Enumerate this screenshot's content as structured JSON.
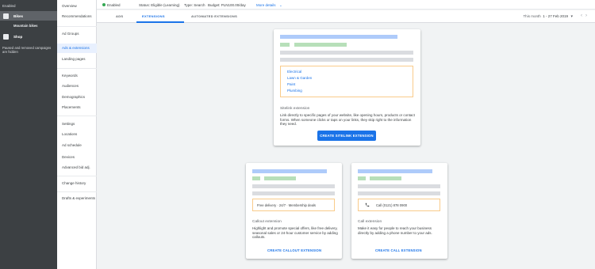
{
  "dark_nav": {
    "enabled_label": "Enabled",
    "campaigns": [
      {
        "label": "Bikes"
      },
      {
        "label": "Shop"
      }
    ],
    "adgroup_label": "Mountain bikes",
    "hidden_note": "Paused and removed campaigns are hidden"
  },
  "sub_nav": {
    "items": [
      "Overview",
      "Recommendations",
      "Ad Groups",
      "Ads & extensions",
      "Landing pages",
      "Keywords",
      "Audiences",
      "Demographics",
      "Placements",
      "Settings",
      "Locations",
      "Ad schedule",
      "Devices",
      "Advanced bid adj.",
      "Change history",
      "Drafts & experiments"
    ],
    "active_index": 3
  },
  "status_bar": {
    "status": "Enabled",
    "campaign_status": "Status: Eligible (Learning)",
    "type": "Type: Search",
    "budget": "Budget: PLN100.00/day",
    "more": "More details"
  },
  "tabs": {
    "items": [
      "ADS",
      "EXTENSIONS",
      "AUTOMATED EXTENSIONS"
    ],
    "active_index": 1,
    "date_prefix": "This month",
    "date_range": "1 - 27 Feb 2019"
  },
  "sitelink_card": {
    "links": [
      "Electrical",
      "Lawn & Garden",
      "Paint",
      "Plumbing"
    ],
    "title": "Sitelink extension",
    "description": "Link directly to specific pages of your website, like opening hours, products or contact forms. When someone clicks or taps on your links, they skip right to the information they need.",
    "button": "CREATE SITELINK EXTENSION"
  },
  "callout_card": {
    "snippet": "Free delivery · 24/7 · Membership deals",
    "title": "Callout extension",
    "description": "Highlight and promote special offers, like free delivery, seasonal sales or 24-hour customer service by adding callouts.",
    "button": "CREATE CALLOUT EXTENSION"
  },
  "call_card": {
    "snippet": "Call (0121) 878 0900",
    "title": "Call extension",
    "description": "Make it easy for people to reach your business directly by adding a phone number to your ads.",
    "button": "CREATE CALL EXTENSION"
  },
  "colors": {
    "accent": "#1a73e8",
    "enabled_green": "#34a853",
    "nav_dark": "#3c4043",
    "highlight_border": "#f9cb8a"
  }
}
